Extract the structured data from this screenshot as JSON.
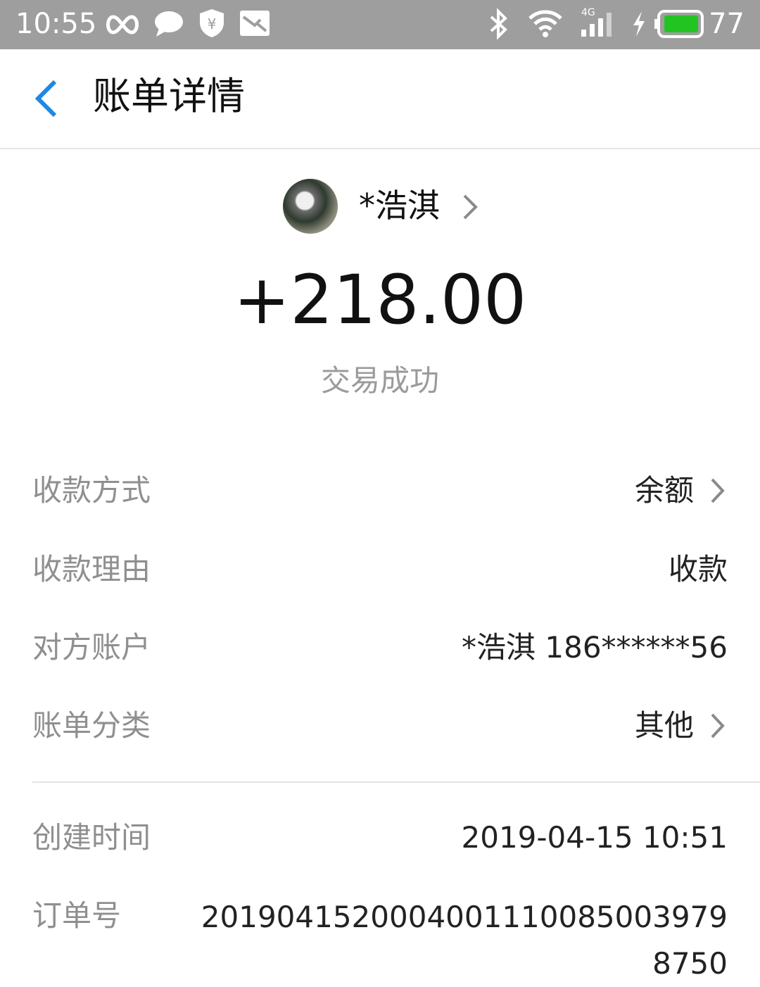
{
  "status_bar": {
    "time": "10:55",
    "battery": "77",
    "network": "4G",
    "icons": [
      "infinity-icon",
      "chat-icon",
      "shield-yen-icon",
      "mail-icon",
      "bluetooth-icon",
      "wifi-icon",
      "signal-icon",
      "charging-icon",
      "battery-icon"
    ],
    "battery_color": "#22c422"
  },
  "header": {
    "title": "账单详情",
    "back_color": "#1e88e5"
  },
  "payee": {
    "name": "*浩淇"
  },
  "amount": "+218.00",
  "status": "交易成功",
  "details": [
    {
      "label": "收款方式",
      "value": "余额"
    },
    {
      "label": "收款理由",
      "value": "收款"
    },
    {
      "label": "对方账户",
      "value": "*浩淇 186******56"
    },
    {
      "label": "账单分类",
      "value": "其他"
    }
  ],
  "meta": {
    "created_label": "创建时间",
    "created_value": "2019-04-15 10:51",
    "order_label": "订单号",
    "order_value": "2019041520004001110085003979875​0"
  }
}
